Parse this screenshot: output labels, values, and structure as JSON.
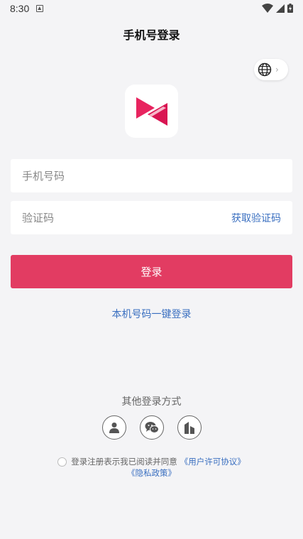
{
  "status": {
    "time": "8:30"
  },
  "header": {
    "title": "手机号登录"
  },
  "language": {
    "chevron": "›"
  },
  "form": {
    "phone_placeholder": "手机号码",
    "code_placeholder": "验证码",
    "get_code_label": "获取验证码",
    "login_label": "登录",
    "one_key_label": "本机号码一键登录"
  },
  "other_login": {
    "title": "其他登录方式",
    "icons": [
      "person-icon",
      "wechat-icon",
      "building-icon"
    ]
  },
  "agreement": {
    "text": "登录注册表示我已阅读并同意",
    "license_link": "《用户许可协议》",
    "privacy_link": "《隐私政策》"
  },
  "colors": {
    "accent": "#e23c62",
    "link": "#3a6fc0",
    "background": "#f4f4f6"
  }
}
